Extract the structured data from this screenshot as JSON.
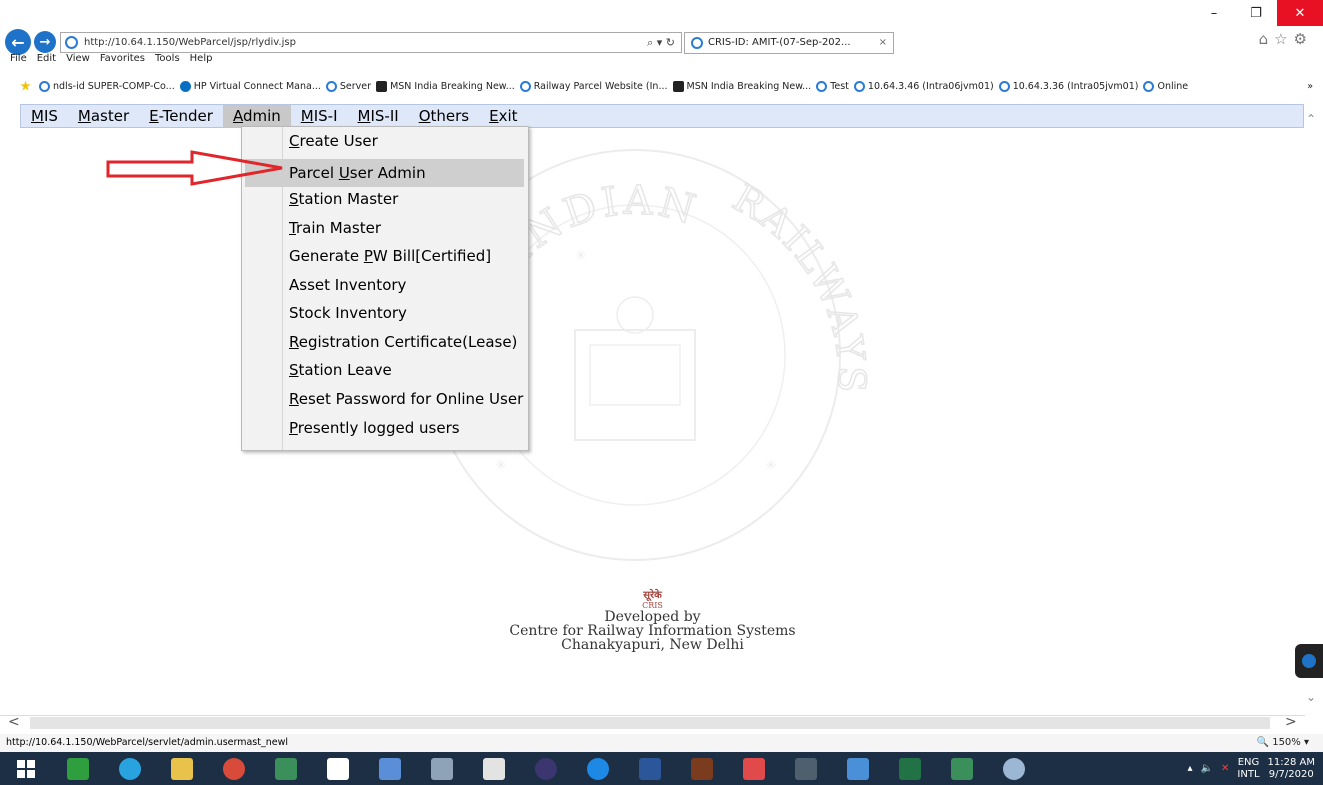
{
  "browser": {
    "url": "http://10.64.1.150/WebParcel/jsp/rlydiv.jsp",
    "tab_title": "CRIS-ID: AMIT-(07-Sep-202...",
    "tab_close": "×",
    "addr_tools": "⌕ ▾ ↻",
    "right_icons": "⌂☆⚙",
    "window_controls": {
      "minimize": "–",
      "maximize": "❐",
      "close": "✕"
    },
    "menu": [
      "File",
      "Edit",
      "View",
      "Favorites",
      "Tools",
      "Help"
    ],
    "favorites": [
      {
        "label": "ndls-id SUPER-COMP-Co...",
        "icon": "ie"
      },
      {
        "label": "HP Virtual Connect Mana...",
        "icon": "hp"
      },
      {
        "label": "Server",
        "icon": "ie"
      },
      {
        "label": "MSN India  Breaking New...",
        "icon": "msn"
      },
      {
        "label": "Railway Parcel Website (In...",
        "icon": "ie"
      },
      {
        "label": "MSN India  Breaking New...",
        "icon": "msn"
      },
      {
        "label": "Test",
        "icon": "ie"
      },
      {
        "label": "10.64.3.46 (Intra06jvm01)",
        "icon": "ie"
      },
      {
        "label": "10.64.3.36 (Intra05jvm01)",
        "icon": "ie"
      },
      {
        "label": "Online",
        "icon": "ie"
      }
    ],
    "fav_more": "»",
    "status_url": "http://10.64.1.150/WebParcel/servlet/admin.usermast_newl",
    "zoom": "150%"
  },
  "app_menu": [
    {
      "pre": "",
      "ul": "M",
      "post": "IS"
    },
    {
      "pre": "",
      "ul": "M",
      "post": "aster"
    },
    {
      "pre": "",
      "ul": "E",
      "post": "-Tender"
    },
    {
      "pre": "",
      "ul": "A",
      "post": "dmin"
    },
    {
      "pre": "",
      "ul": "M",
      "post": "IS-I"
    },
    {
      "pre": "",
      "ul": "M",
      "post": "IS-II"
    },
    {
      "pre": "",
      "ul": "O",
      "post": "thers"
    },
    {
      "pre": "",
      "ul": "E",
      "post": "xit"
    }
  ],
  "admin_dropdown": [
    {
      "pre": "",
      "ul": "C",
      "post": "reate User"
    },
    {
      "pre": "Parcel ",
      "ul": "U",
      "post": "ser Admin"
    },
    {
      "pre": "",
      "ul": "S",
      "post": "tation Master"
    },
    {
      "pre": "",
      "ul": "T",
      "post": "rain Master"
    },
    {
      "pre": "Generate ",
      "ul": "P",
      "post": "W Bill[Certified]"
    },
    {
      "pre": "Asset Inventory",
      "ul": "",
      "post": ""
    },
    {
      "pre": "Stock Inventory",
      "ul": "",
      "post": ""
    },
    {
      "pre": "",
      "ul": "R",
      "post": "egistration Certificate(Lease)"
    },
    {
      "pre": "",
      "ul": "S",
      "post": "tation Leave"
    },
    {
      "pre": "",
      "ul": "R",
      "post": "eset Password for Online User"
    },
    {
      "pre": "",
      "ul": "P",
      "post": "resently logged users"
    }
  ],
  "footer": {
    "logo_top": "सूरेके",
    "logo_bottom": "CRIS",
    "line1": "Developed by",
    "line2": "Centre for Railway Information Systems",
    "line3": "Chanakyapuri, New Delhi"
  },
  "watermark": {
    "top": "INDIAN",
    "right": "RAILWAYS"
  },
  "tray": {
    "lang1": "ENG",
    "lang2": "INTL",
    "time": "11:28 AM",
    "date": "9/7/2020"
  },
  "scroll": {
    "up": "⌃",
    "down": "⌄",
    "left": "<",
    "right": ">"
  },
  "colors": {
    "accent": "#1e73c8",
    "menubar_bg": "#dfe8f8",
    "highlight": "#cfcfcf",
    "arrow": "#e0262b",
    "taskbar": "#1c2f44"
  }
}
